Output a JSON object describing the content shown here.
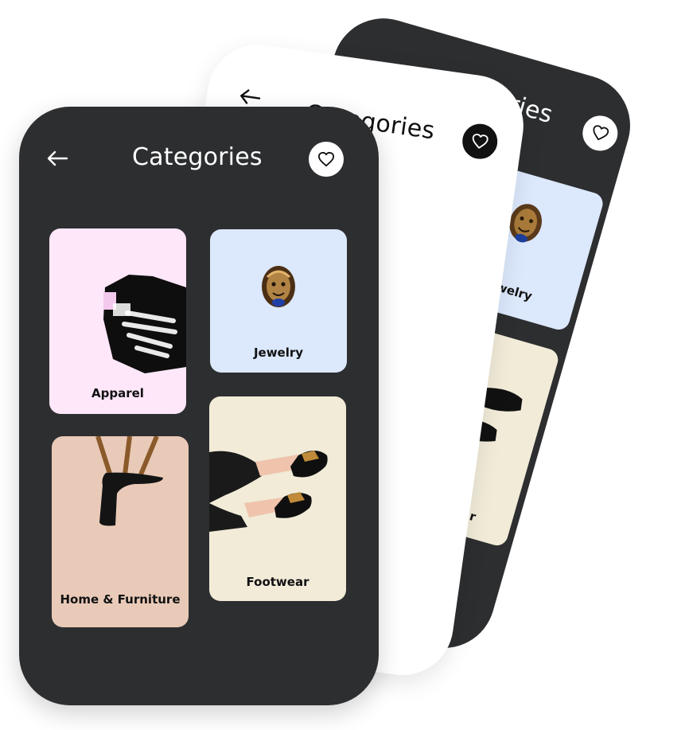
{
  "screen": {
    "title": "Categories",
    "back_label": "Back",
    "favorite_label": "Favorites"
  },
  "categories": [
    {
      "name": "Apparel",
      "color": "#fde7f9"
    },
    {
      "name": "Jewelry",
      "color": "#dce8fc"
    },
    {
      "name": "Home & Furniture",
      "color": "#e9cab8"
    },
    {
      "name": "Footwear",
      "color": "#f1ebd8"
    }
  ],
  "back_card": {
    "title": "Categories",
    "jewelry_label": "Jewelry",
    "footwear_label": "Footwear"
  },
  "middle_card": {
    "title": "Categories"
  },
  "colors": {
    "phone_dark": "#2d2e30",
    "phone_light": "#ffffff",
    "icon_dark": "#111111"
  },
  "icons": {
    "back": "arrow-left-icon",
    "favorite": "heart-icon"
  }
}
